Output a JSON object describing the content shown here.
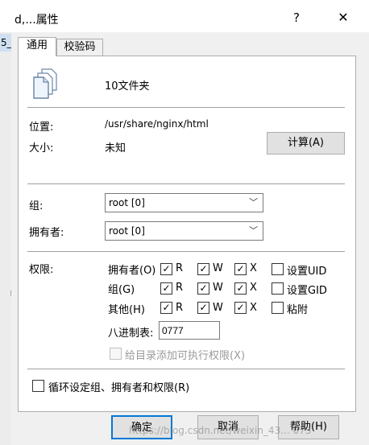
{
  "window": {
    "title": "d,...属性",
    "help_glyph": "?",
    "close_glyph": "✕"
  },
  "background": {
    "left_tab_text": "5_"
  },
  "tabs": [
    {
      "label": "通用"
    },
    {
      "label": "校验码"
    }
  ],
  "general": {
    "file_summary": "10文件夹",
    "location_label": "位置:",
    "location_value": "/usr/share/nginx/html",
    "size_label": "大小:",
    "size_value": "未知",
    "calculate_button": "计算(A)",
    "group_label": "组:",
    "group_value": "root [0]",
    "owner_label": "拥有者:",
    "owner_value": "root [0]"
  },
  "permissions": {
    "label": "权限:",
    "rows": [
      {
        "name": "拥有者(O)",
        "r": true,
        "w": true,
        "x": true,
        "extra_label": "设置UID",
        "extra_checked": false
      },
      {
        "name": "组(G)",
        "r": true,
        "w": true,
        "x": true,
        "extra_label": "设置GID",
        "extra_checked": false
      },
      {
        "name": "其他(H)",
        "r": true,
        "w": true,
        "x": true,
        "extra_label": "粘附",
        "extra_checked": false
      }
    ],
    "col_r": "R",
    "col_w": "W",
    "col_x": "X",
    "octal_label": "八进制表:",
    "octal_value": "0777",
    "dir_exec_label": "给目录添加可执行权限(X)",
    "dir_exec_checked": false
  },
  "recursive_label": "循环设定组、拥有者和权限(R)",
  "recursive_checked": false,
  "buttons": {
    "ok": "确定",
    "cancel": "取消",
    "help": "帮助(H)"
  },
  "watermark": "https://blog.csdn.net/weixin_43... 073"
}
